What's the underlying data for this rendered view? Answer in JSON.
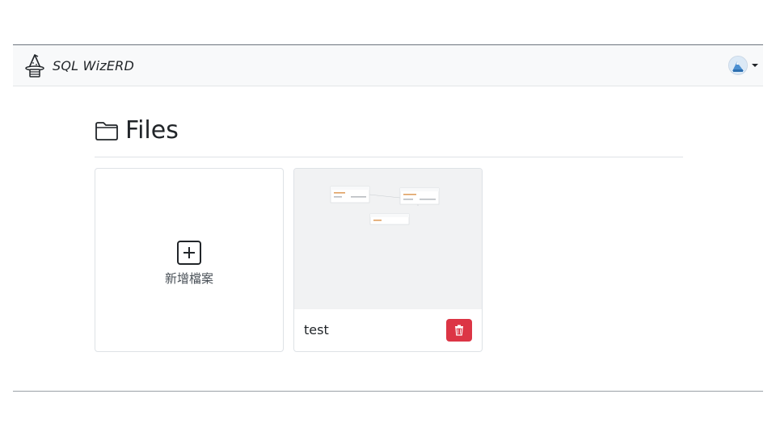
{
  "app": {
    "name": "SQL WizERD",
    "logo_icon": "wizard-hat-logo-icon"
  },
  "navbar": {
    "background": "#f8f9fa",
    "user_avatar_icon": "user-avatar-icon",
    "dropdown_icon": "caret-down-icon"
  },
  "page": {
    "title": "Files",
    "title_icon": "folder-icon"
  },
  "files": {
    "new_file_label": "新增檔案",
    "new_file_icon": "plus-square-icon",
    "items": [
      {
        "name": "test",
        "delete_icon": "trash-icon",
        "delete_color": "#dc3545"
      }
    ]
  }
}
